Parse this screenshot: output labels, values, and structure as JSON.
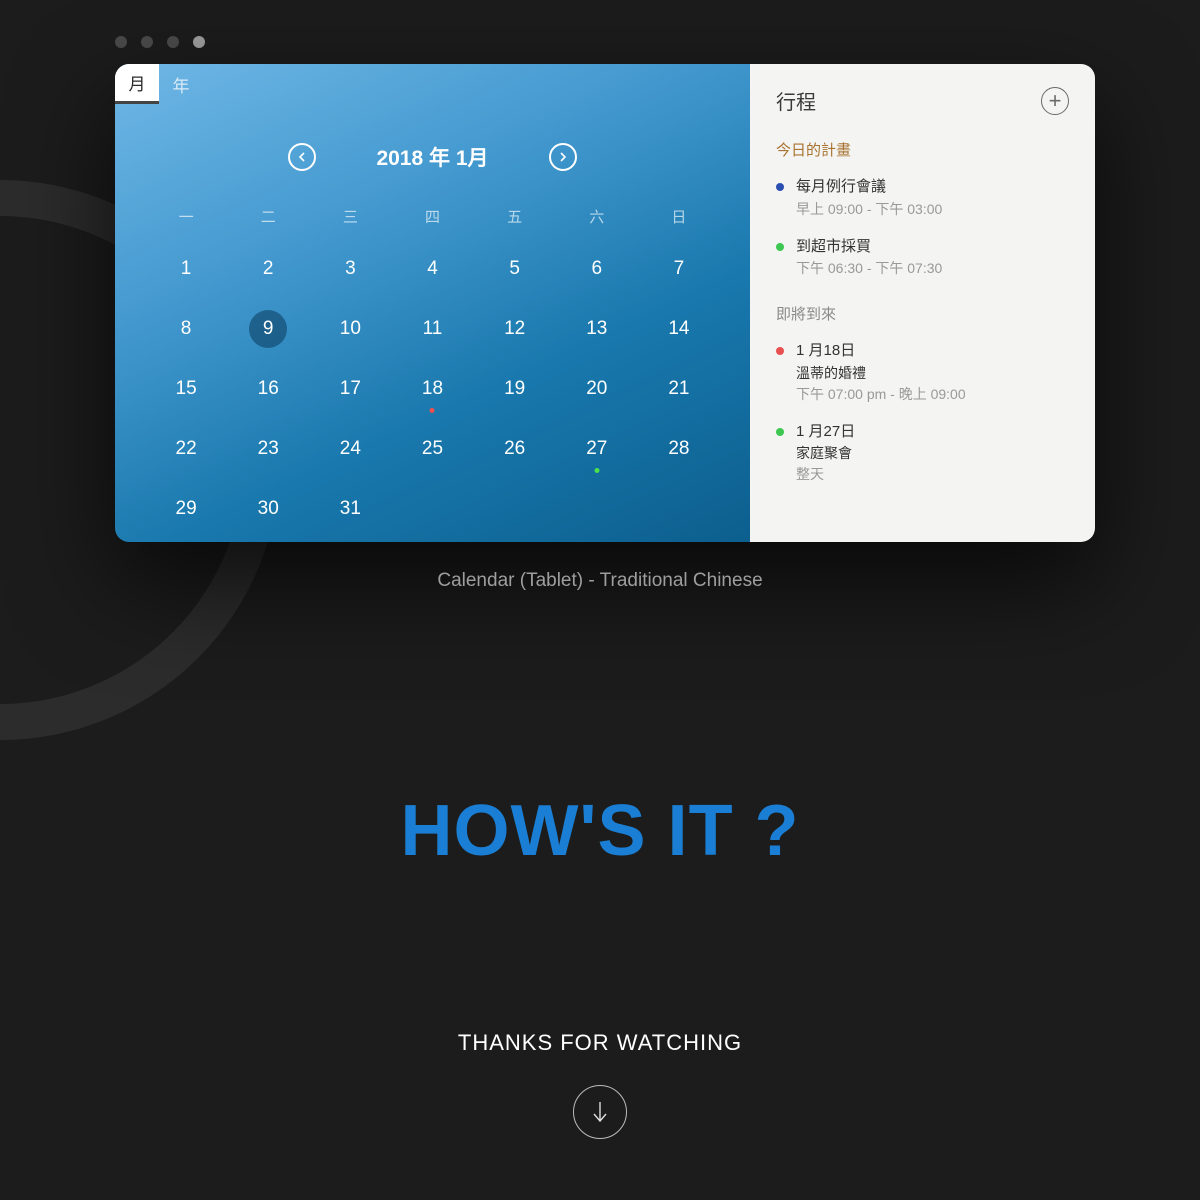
{
  "calendar": {
    "tabs": {
      "month": "月",
      "year": "年",
      "active": "month"
    },
    "title": "2018 年 1月",
    "weekdays": [
      "一",
      "二",
      "三",
      "四",
      "五",
      "六",
      "日"
    ],
    "selected_day": 9,
    "weeks": [
      [
        1,
        2,
        3,
        4,
        5,
        6,
        7
      ],
      [
        8,
        9,
        10,
        11,
        12,
        13,
        14
      ],
      [
        15,
        16,
        17,
        18,
        19,
        20,
        21
      ],
      [
        22,
        23,
        24,
        25,
        26,
        27,
        28
      ],
      [
        29,
        30,
        31,
        null,
        null,
        null,
        null
      ]
    ],
    "markers": {
      "18": "red",
      "27": "green"
    }
  },
  "sidebar": {
    "title": "行程",
    "today_heading": "今日的計畫",
    "today_events": [
      {
        "color": "blue",
        "title": "每月例行會議",
        "time": "早上 09:00 - 下午 03:00"
      },
      {
        "color": "green",
        "title": "到超市採買",
        "time": "下午 06:30 - 下午 07:30"
      }
    ],
    "upcoming_heading": "即將到來",
    "upcoming_events": [
      {
        "color": "red",
        "date": "1 月18日",
        "title": "溫蒂的婚禮",
        "time": "下午 07:00 pm - 晚上 09:00"
      },
      {
        "color": "green",
        "date": "1 月27日",
        "title": "家庭聚會",
        "time": "整天"
      }
    ]
  },
  "caption": "Calendar (Tablet) - Traditional Chinese",
  "hows": "HOW'S IT ?",
  "thanks": "THANKS FOR WATCHING"
}
